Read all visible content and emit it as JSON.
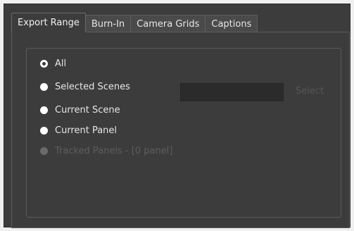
{
  "tabs": [
    {
      "label": "Export Range",
      "active": true
    },
    {
      "label": "Burn-In",
      "active": false
    },
    {
      "label": "Camera Grids",
      "active": false
    },
    {
      "label": "Captions",
      "active": false
    }
  ],
  "range_options": {
    "all": {
      "label": "All",
      "selected": true,
      "enabled": true
    },
    "selected_scenes": {
      "label": "Selected Scenes",
      "selected": false,
      "enabled": true
    },
    "current_scene": {
      "label": "Current Scene",
      "selected": false,
      "enabled": true
    },
    "current_panel": {
      "label": "Current Panel",
      "selected": false,
      "enabled": true
    },
    "tracked_panels": {
      "label": "Tracked Panels - [0 panel]",
      "selected": false,
      "enabled": false
    }
  },
  "selected_scenes_field": {
    "value": ""
  },
  "select_button": {
    "label": "Select",
    "enabled": false
  },
  "colors": {
    "panel_bg": "#3c3c3c",
    "text": "#e6e6e6",
    "disabled_text": "#5e5e5e",
    "field_bg": "#2b2b2b"
  }
}
